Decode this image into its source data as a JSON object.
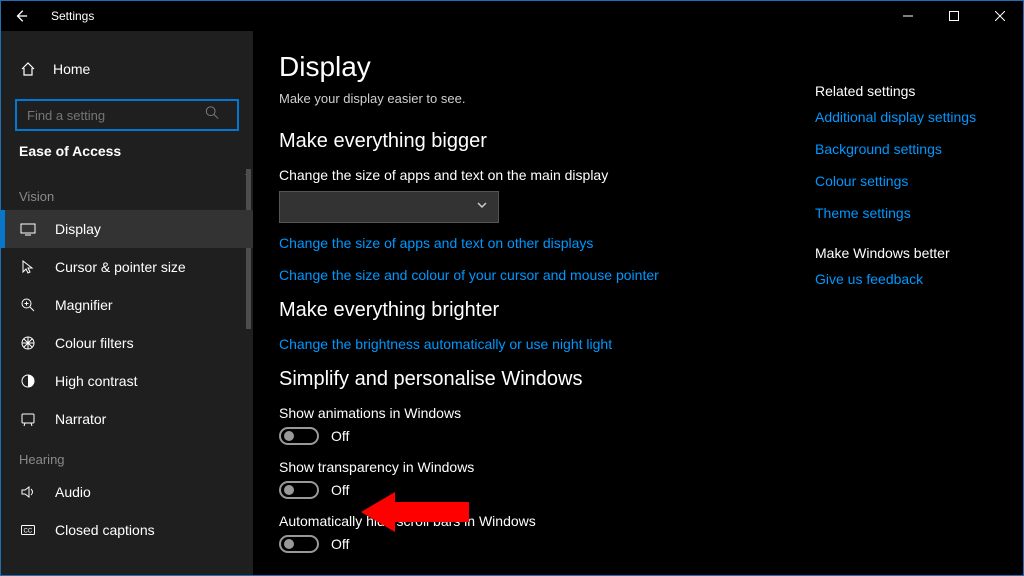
{
  "titlebar": {
    "title": "Settings"
  },
  "sidebar": {
    "home_label": "Home",
    "search_placeholder": "Find a setting",
    "breadcrumb": "Ease of Access",
    "categories": [
      {
        "label": "Vision",
        "items": [
          {
            "label": "Display",
            "icon": "display",
            "active": true
          },
          {
            "label": "Cursor & pointer size",
            "icon": "cursor"
          },
          {
            "label": "Magnifier",
            "icon": "magnifier"
          },
          {
            "label": "Colour filters",
            "icon": "colour-filters"
          },
          {
            "label": "High contrast",
            "icon": "high-contrast"
          },
          {
            "label": "Narrator",
            "icon": "narrator"
          }
        ]
      },
      {
        "label": "Hearing",
        "items": [
          {
            "label": "Audio",
            "icon": "audio"
          },
          {
            "label": "Closed captions",
            "icon": "cc"
          }
        ]
      }
    ]
  },
  "main": {
    "title": "Display",
    "subtitle": "Make your display easier to see.",
    "sections": {
      "bigger": {
        "heading": "Make everything bigger",
        "label": "Change the size of apps and text on the main display",
        "link1": "Change the size of apps and text on other displays",
        "link2": "Change the size and colour of your cursor and mouse pointer"
      },
      "brighter": {
        "heading": "Make everything brighter",
        "link1": "Change the brightness automatically or use night light"
      },
      "simplify": {
        "heading": "Simplify and personalise Windows",
        "toggles": [
          {
            "label": "Show animations in Windows",
            "state": "Off"
          },
          {
            "label": "Show transparency in Windows",
            "state": "Off"
          },
          {
            "label": "Automatically hide scroll bars in Windows",
            "state": "Off"
          }
        ]
      }
    }
  },
  "rightcol": {
    "related_heading": "Related settings",
    "related_links": [
      "Additional display settings",
      "Background settings",
      "Colour settings",
      "Theme settings"
    ],
    "feedback_heading": "Make Windows better",
    "feedback_link": "Give us feedback"
  }
}
